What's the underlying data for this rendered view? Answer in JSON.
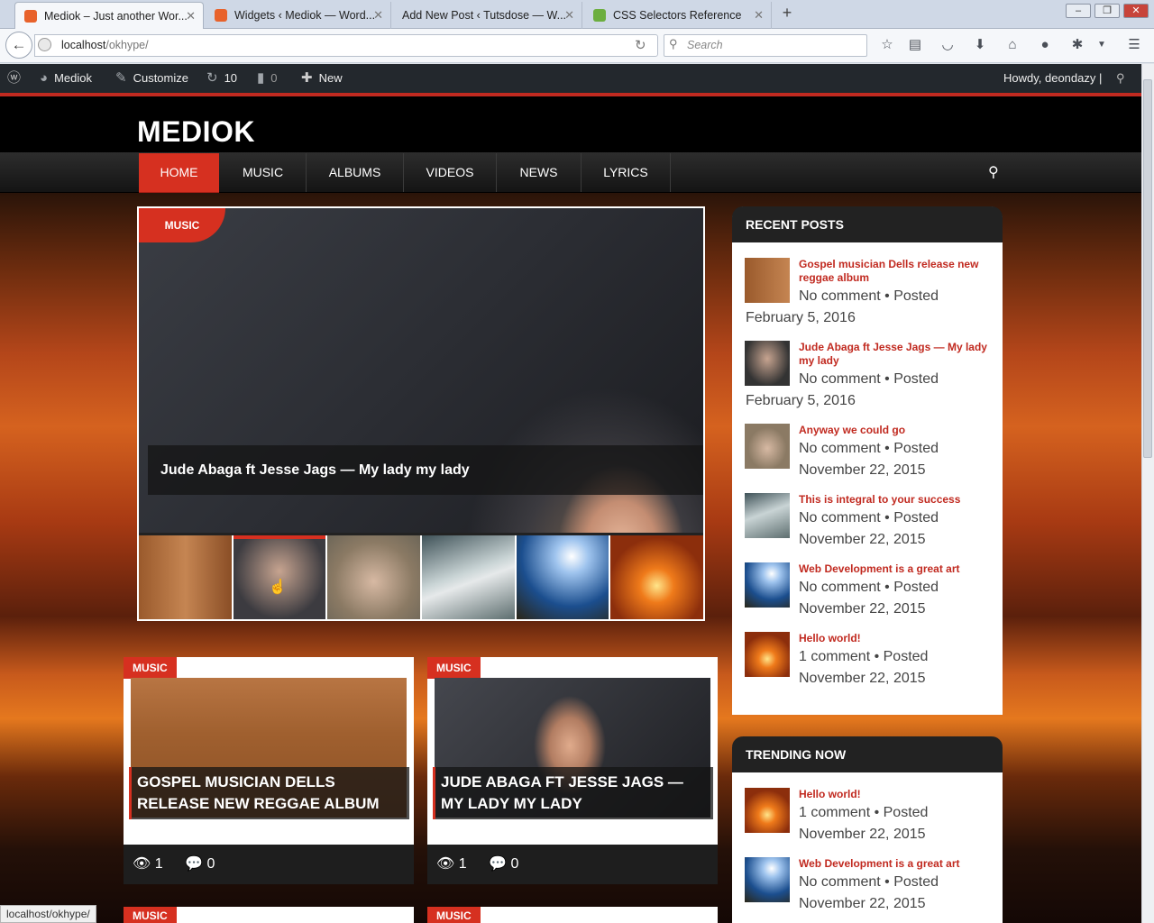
{
  "browser": {
    "tabs": [
      {
        "label": "Mediok – Just another Wor...",
        "active": true
      },
      {
        "label": "Widgets ‹ Mediok — Word..."
      },
      {
        "label": "Add New Post ‹ Tutsdose — W..."
      },
      {
        "label": "CSS Selectors Reference"
      }
    ],
    "url_host": "localhost",
    "url_path": "/okhype/",
    "search_placeholder": "Search",
    "status_url": "localhost/okhype/"
  },
  "adminbar": {
    "site": "Mediok",
    "customize": "Customize",
    "updates": "10",
    "comments": "0",
    "new": "New",
    "howdy": "Howdy, deondazy"
  },
  "site": {
    "logo": "MEDIOK",
    "nav": [
      "HOME",
      "MUSIC",
      "ALBUMS",
      "VIDEOS",
      "NEWS",
      "LYRICS"
    ]
  },
  "slider": {
    "category": "MUSIC",
    "caption": "Jude Abaga ft Jesse Jags — My lady my lady"
  },
  "recent_posts": {
    "title": "RECENT POSTS",
    "items": [
      {
        "title": "Gospel musician Dells release new reggae album",
        "meta1": "No comment • Posted",
        "meta2": "February 5, 2016"
      },
      {
        "title": "Jude Abaga ft Jesse Jags — My lady my lady",
        "meta1": "No comment • Posted",
        "meta2": "February 5, 2016"
      },
      {
        "title": "Anyway we could go",
        "meta1": "No comment • Posted",
        "meta2": "November 22, 2015"
      },
      {
        "title": "This is integral to your success",
        "meta1": "No comment • Posted",
        "meta2": "November 22, 2015"
      },
      {
        "title": "Web Development is a great art",
        "meta1": "No comment • Posted",
        "meta2": "November 22, 2015"
      },
      {
        "title": "Hello world!",
        "meta1": "1 comment • Posted",
        "meta2": "November 22, 2015"
      }
    ]
  },
  "trending": {
    "title": "TRENDING NOW",
    "items": [
      {
        "title": "Hello world!",
        "meta1": "1 comment • Posted",
        "meta2": "November 22, 2015"
      },
      {
        "title": "Web Development is a great art",
        "meta1": "No comment • Posted",
        "meta2": "November 22, 2015"
      }
    ]
  },
  "cards": [
    {
      "category": "MUSIC",
      "title": "GOSPEL MUSICIAN DELLS RELEASE NEW REGGAE ALBUM",
      "views": "1",
      "comments": "0"
    },
    {
      "category": "MUSIC",
      "title": "JUDE ABAGA FT JESSE JAGS — MY LADY MY LADY",
      "views": "1",
      "comments": "0"
    },
    {
      "category": "MUSIC"
    },
    {
      "category": "MUSIC"
    }
  ]
}
